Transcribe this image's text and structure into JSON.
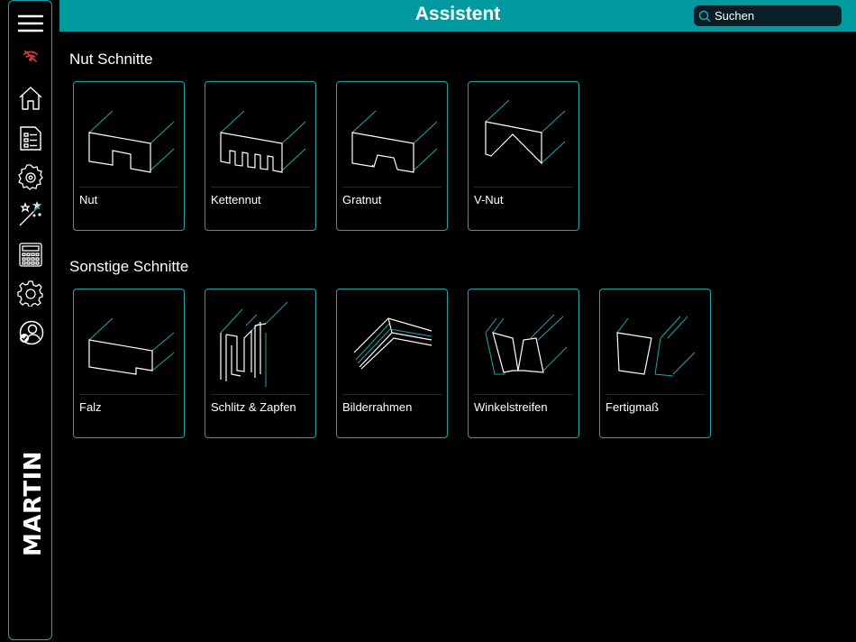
{
  "header": {
    "title": "Assistent"
  },
  "search": {
    "placeholder": "Suchen"
  },
  "sidebar": {
    "items": [
      {
        "icon": "menu-icon"
      },
      {
        "icon": "wifi-off-icon"
      },
      {
        "icon": "home-icon"
      },
      {
        "icon": "list-icon"
      },
      {
        "icon": "saw-blade-icon"
      },
      {
        "icon": "magic-wand-icon"
      },
      {
        "icon": "calculator-icon"
      },
      {
        "icon": "gear-icon"
      },
      {
        "icon": "user-check-icon"
      }
    ],
    "logo": "MARTIN"
  },
  "sections": [
    {
      "title": "Nut Schnitte",
      "cards": [
        {
          "label": "Nut"
        },
        {
          "label": "Kettennut"
        },
        {
          "label": "Gratnut"
        },
        {
          "label": "V-Nut"
        }
      ]
    },
    {
      "title": "Sonstige Schnitte",
      "cards": [
        {
          "label": "Falz"
        },
        {
          "label": "Schlitz & Zapfen"
        },
        {
          "label": "Bilderrahmen"
        },
        {
          "label": "Winkelstreifen"
        },
        {
          "label": "Fertigmaß"
        }
      ]
    }
  ],
  "colors": {
    "accent": "#009aa0",
    "border": "#1aa6ad",
    "warning": "#e0353b"
  }
}
